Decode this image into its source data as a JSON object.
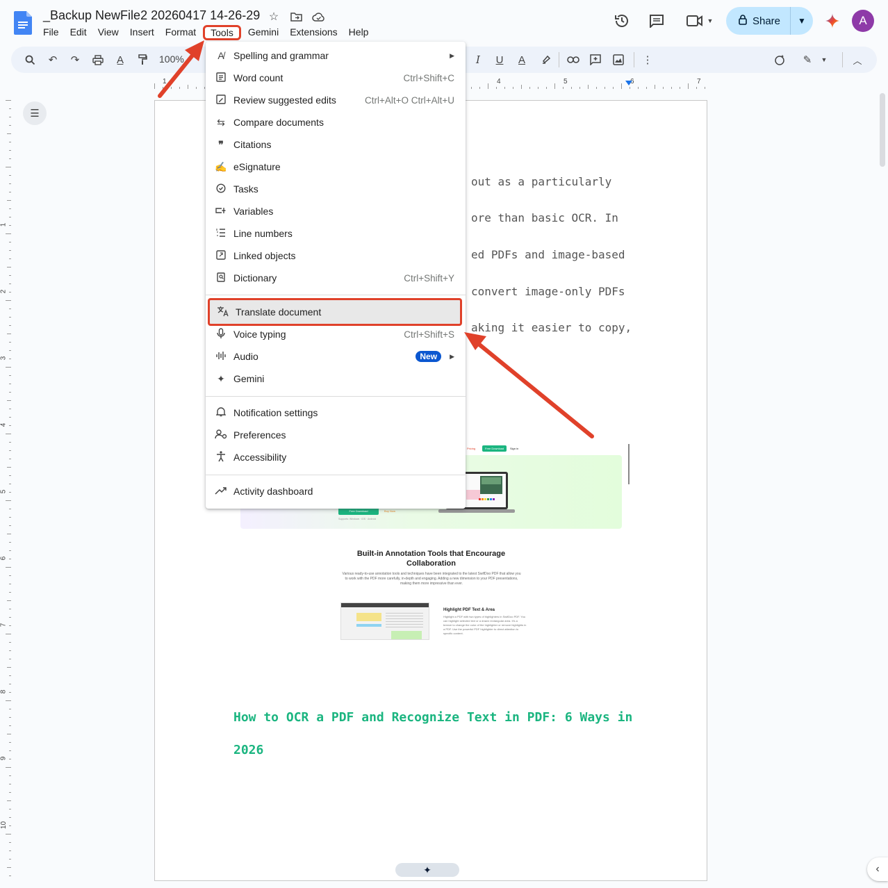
{
  "document": {
    "title": "_Backup NewFile2 20260417 14-26-29"
  },
  "menubar": [
    "File",
    "Edit",
    "View",
    "Insert",
    "Format",
    "Tools",
    "Gemini",
    "Extensions",
    "Help"
  ],
  "header": {
    "share_label": "Share",
    "avatar_letter": "A"
  },
  "toolbar": {
    "zoom": "100%"
  },
  "ruler": {
    "h_numbers": [
      "1",
      "4",
      "5",
      "6",
      "7"
    ],
    "v_numbers": [
      "1",
      "2",
      "3",
      "4",
      "5",
      "6",
      "7",
      "8",
      "9",
      "10"
    ]
  },
  "tools_menu": {
    "items": [
      {
        "label": "Spelling and grammar",
        "shortcut": "",
        "icon": "spellcheck-icon",
        "submenu": true
      },
      {
        "label": "Word count",
        "shortcut": "Ctrl+Shift+C",
        "icon": "word-count-icon"
      },
      {
        "label": "Review suggested edits",
        "shortcut": "Ctrl+Alt+O Ctrl+Alt+U",
        "icon": "review-edits-icon"
      },
      {
        "label": "Compare documents",
        "shortcut": "",
        "icon": "compare-icon"
      },
      {
        "label": "Citations",
        "shortcut": "",
        "icon": "quote-icon"
      },
      {
        "label": "eSignature",
        "shortcut": "",
        "icon": "signature-icon"
      },
      {
        "label": "Tasks",
        "shortcut": "",
        "icon": "task-check-icon"
      },
      {
        "label": "Variables",
        "shortcut": "",
        "icon": "variables-icon"
      },
      {
        "label": "Line numbers",
        "shortcut": "",
        "icon": "line-numbers-icon"
      },
      {
        "label": "Linked objects",
        "shortcut": "",
        "icon": "linked-objects-icon"
      },
      {
        "label": "Dictionary",
        "shortcut": "Ctrl+Shift+Y",
        "icon": "dictionary-icon"
      },
      {
        "label": "Translate document",
        "shortcut": "",
        "icon": "translate-icon"
      },
      {
        "label": "Voice typing",
        "shortcut": "Ctrl+Shift+S",
        "icon": "microphone-icon"
      },
      {
        "label": "Audio",
        "shortcut": "",
        "icon": "audio-wave-icon",
        "badge": "New",
        "submenu": true
      },
      {
        "label": "Gemini",
        "shortcut": "",
        "icon": "gemini-spark-icon"
      },
      {
        "label": "Notification settings",
        "shortcut": "",
        "icon": "bell-icon"
      },
      {
        "label": "Preferences",
        "shortcut": "",
        "icon": "preferences-icon"
      },
      {
        "label": "Accessibility",
        "shortcut": "",
        "icon": "accessibility-icon"
      },
      {
        "label": "Activity dashboard",
        "shortcut": "",
        "icon": "trending-up-icon"
      }
    ]
  },
  "page": {
    "body_lines": [
      "out as a particularly",
      "ore than basic OCR. In",
      "ed PDFs and image-based",
      "convert image-only PDFs",
      "aking it easier to copy,"
    ],
    "heading_lines": [
      "How to OCR a PDF and Recognize Text in PDF: 6 Ways in",
      "2026"
    ]
  },
  "embedded_image": {
    "nav_pricing": "Pricing",
    "nav_download": "Free Download",
    "nav_signin": "Sign in",
    "banner_download": "Free Download",
    "banner_try": "Buy Now",
    "banner_support": "Supports: Windows · iOS · Android",
    "section_title_1": "Built-in Annotation Tools that Encourage",
    "section_title_2": "Collaboration",
    "section_text": "Various ready-to-use annotation tools and techniques have been integrated to the latest SwifDoo PDF that allow you to work with the PDF more carefully, in-depth and engaging. Adding a new dimension to your PDF presentations, making them more impressive than ever.",
    "feature_title": "Highlight PDF Text & Area",
    "feature_text": "Highlight a PDF with two types of highlighters in SwifDoo PDF. You can highlight selected text or a drawn rectangular area. It's a breeze to change the color of the highlighter or remove highlights in a PDF. Use the powerful PDF highlighter to direct attention to specific content."
  },
  "colors": {
    "accent_red": "#e0412a",
    "heading_green": "#1bb580",
    "share_bg": "#c2e7ff",
    "badge_blue": "#0b57d0"
  }
}
